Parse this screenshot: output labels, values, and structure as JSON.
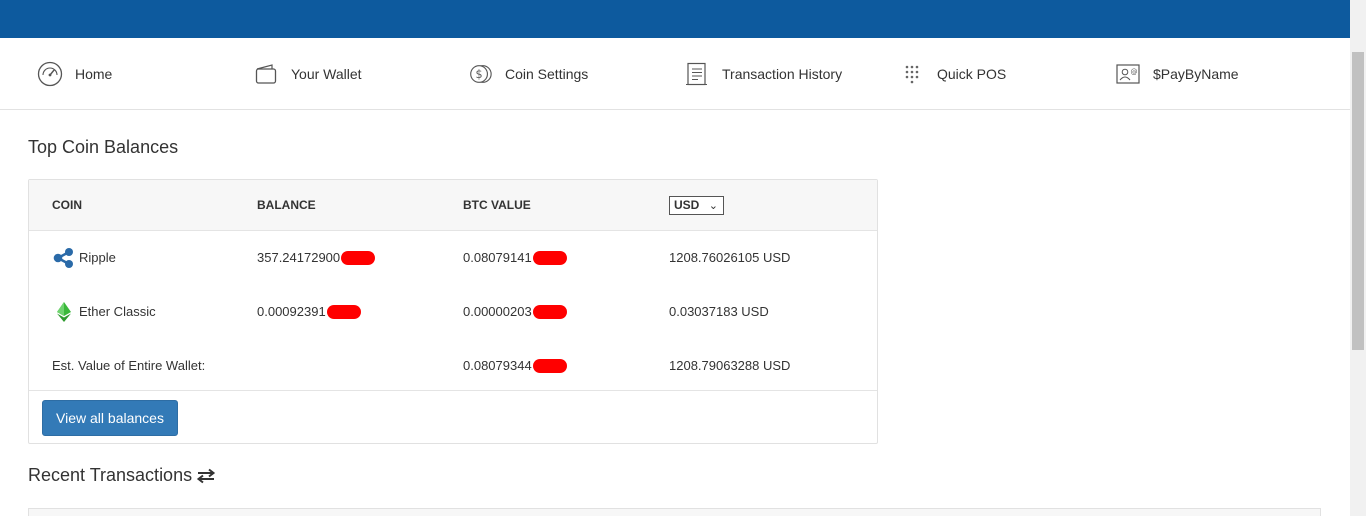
{
  "nav": {
    "items": [
      {
        "label": "Home",
        "icon": "speedometer-icon"
      },
      {
        "label": "Your Wallet",
        "icon": "wallet-icon"
      },
      {
        "label": "Coin Settings",
        "icon": "coins-icon"
      },
      {
        "label": "Transaction History",
        "icon": "receipt-icon"
      },
      {
        "label": "Quick POS",
        "icon": "keypad-icon"
      },
      {
        "label": "$PayByName",
        "icon": "id-card-icon"
      }
    ]
  },
  "balances": {
    "title": "Top Coin Balances",
    "columns": {
      "coin": "COIN",
      "balance": "BALANCE",
      "btc_value": "BTC VALUE",
      "currency": "USD"
    },
    "rows": [
      {
        "coin": "Ripple",
        "icon": "ripple-icon",
        "balance": "357.24172900",
        "btc_value": "0.08079141",
        "usd_value": "1208.76026105 USD"
      },
      {
        "coin": "Ether Classic",
        "icon": "ethereum-classic-icon",
        "balance": "0.00092391",
        "btc_value": "0.00000203",
        "usd_value": "0.03037183 USD"
      }
    ],
    "total": {
      "label": "Est. Value of Entire Wallet:",
      "btc_value": "0.08079344",
      "usd_value": "1208.79063288 USD"
    },
    "view_all_label": "View all balances"
  },
  "recent": {
    "title": "Recent Transactions"
  },
  "colors": {
    "topbar": "#0d5a9e",
    "button": "#337ab7",
    "redaction": "#ff0000"
  }
}
